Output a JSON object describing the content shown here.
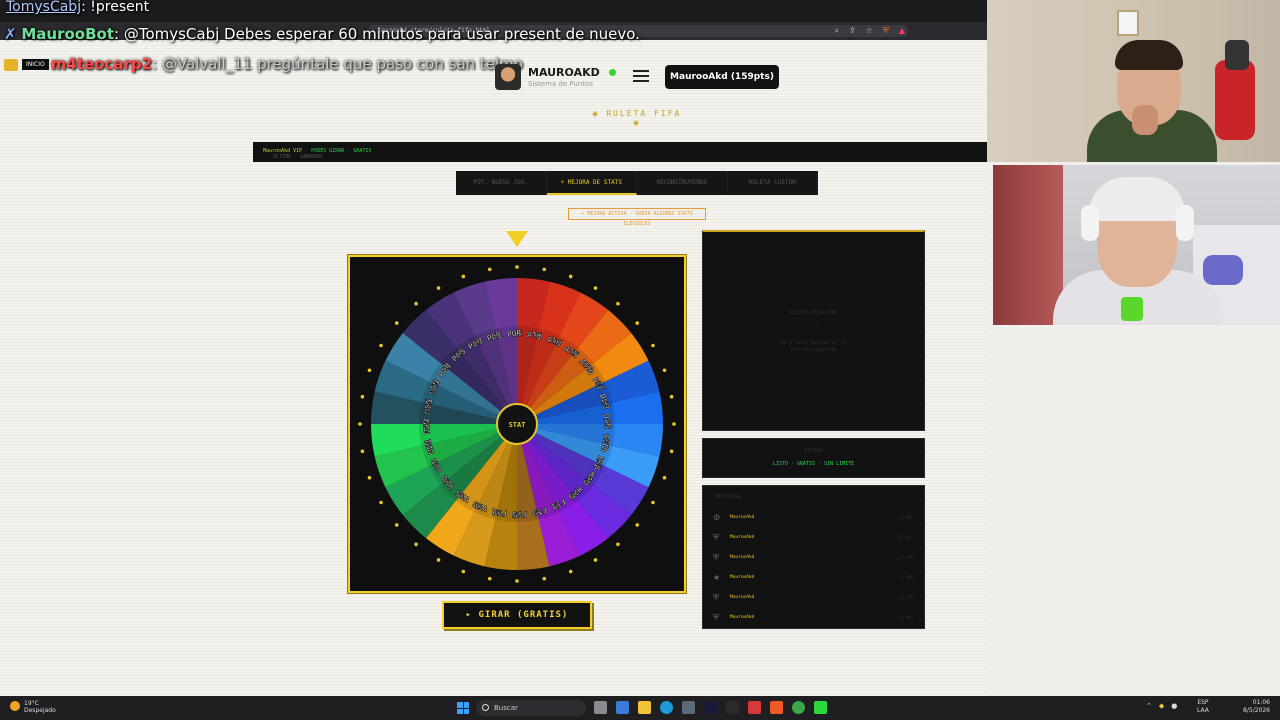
{
  "chat": [
    {
      "user": "TomysCabj",
      "message": ": !present"
    },
    {
      "user": "MaurooBot",
      "message": ": @TomysCabj Debes esperar 60 minutos para usar present de nuevo."
    },
    {
      "badge": "INICIO",
      "user": "m4teocarp2",
      "message": ": @Valvall_11 pregúntale que paso con san telmo"
    }
  ],
  "browser": {
    "url": "mauroakd.store/ruleta-fifa.html"
  },
  "header": {
    "site_name": "MAUROAKD",
    "site_sub": "Sistema de Puntos",
    "points_button": "MaurooAkd (159pts)",
    "page_title": "RULETA FIFA"
  },
  "ticker": {
    "prefix": "ÚLTIMO · GANADOR:",
    "user": "MaurooAkd VIP",
    "status": "PODÉS GIRAR · GRATIS"
  },
  "tabs": [
    {
      "label": "POT. NUEVO JUG.",
      "active": false
    },
    {
      "label": "+ MEJORA DE STATS",
      "active": true
    },
    {
      "label": "RECONSTRUYENDO",
      "active": false
    },
    {
      "label": "RULETA CUSTOM",
      "active": false
    }
  ],
  "notice": "+ MEJORA ACTIVA · SUBIR ALGUNOS STATS ELEGIBLES",
  "wheel": {
    "center_label": "STAT",
    "segments": [
      {
        "label": "+5 ATK",
        "color": "#c6281e"
      },
      {
        "label": "+1 ATK",
        "color": "#d9321a"
      },
      {
        "label": "+3 ATK",
        "color": "#e3461a"
      },
      {
        "label": "+5 ATK",
        "color": "#ea6a16"
      },
      {
        "label": "+10 DEF",
        "color": "#f08a10"
      },
      {
        "label": "+1 DEF",
        "color": "#1c5bd6"
      },
      {
        "label": "+3 DEF",
        "color": "#1a6ef0"
      },
      {
        "label": "+5 DEF",
        "color": "#2b86f5"
      },
      {
        "label": "+10 HAB",
        "color": "#3a9cf5"
      },
      {
        "label": "+1 HAB",
        "color": "#5a3ad6"
      },
      {
        "label": "+3 HAB",
        "color": "#6a2ae0"
      },
      {
        "label": "+5 FIS",
        "color": "#8a1ee8"
      },
      {
        "label": "+1 FIS",
        "color": "#9a1ed6"
      },
      {
        "label": "+3 FIS",
        "color": "#a8701e"
      },
      {
        "label": "+5 FIS",
        "color": "#b8820e"
      },
      {
        "label": "+1 VEL",
        "color": "#d89a1a"
      },
      {
        "label": "+3 VEL",
        "color": "#f0a81a"
      },
      {
        "label": "+5 VEL",
        "color": "#1e8a4a"
      },
      {
        "label": "+1 VEL",
        "color": "#1ea456"
      },
      {
        "label": "+5 MEN",
        "color": "#22c44e"
      },
      {
        "label": "+1 MEN",
        "color": "#1fdc5a"
      },
      {
        "label": "+3 MEN",
        "color": "#23515f"
      },
      {
        "label": "+5 MEN",
        "color": "#2b6a84"
      },
      {
        "label": "+3 POR",
        "color": "#3a82a8"
      },
      {
        "label": "+1 POR",
        "color": "#3b2f6a"
      },
      {
        "label": "+5 POR",
        "color": "#4a337a"
      },
      {
        "label": "+3 POR",
        "color": "#5a3a8a"
      },
      {
        "label": "+1 POR",
        "color": "#6a3a9a"
      }
    ]
  },
  "spin_button": "GIRAR (GRATIS)",
  "result_panel": {
    "title": "ÚLTIMO RESULTADO",
    "value": "---",
    "hint": "Girá para descubrir tu próximo upgrade"
  },
  "status_panel": {
    "title": "ESTADO",
    "value": "LISTO · GRATIS · SIN LIMITE"
  },
  "history": {
    "title": "HISTORIAL",
    "rows": [
      {
        "icon": "gear-icon",
        "glyph": "⚙",
        "name": "MaurooAkd",
        "value": "+1 DEF"
      },
      {
        "icon": "shield-icon",
        "glyph": "⛨",
        "name": "MaurooAkd",
        "value": "+3 VEL"
      },
      {
        "icon": "shield-icon",
        "glyph": "⛨",
        "name": "MaurooAkd",
        "value": "+5 ATK"
      },
      {
        "icon": "star-icon",
        "glyph": "★",
        "name": "MaurooAkd",
        "value": "+1 HAB"
      },
      {
        "icon": "shield-icon",
        "glyph": "⛨",
        "name": "MaurooAkd",
        "value": "+3 FIS"
      },
      {
        "icon": "shield-icon",
        "glyph": "⛨",
        "name": "MaurooAkd",
        "value": "+5 MEN"
      }
    ]
  },
  "taskbar": {
    "weather_temp": "19°C",
    "weather_desc": "Despejado",
    "search_placeholder": "Buscar",
    "lang_top": "ESP",
    "lang_bottom": "LAA",
    "time": "01:06",
    "date": "8/5/2026"
  }
}
